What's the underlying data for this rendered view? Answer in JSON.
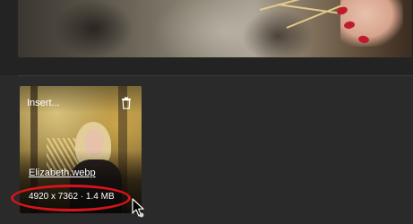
{
  "thumbnail": {
    "insert_label": "Insert...",
    "file_name": "Elizabeth.webp",
    "file_info": "4920 x 7362 · 1.4 MB",
    "delete_icon": "trash-icon"
  },
  "annotation": {
    "highlight_color": "#d7141a"
  },
  "cursor": {
    "icon": "pointer-cursor-icon"
  },
  "colors": {
    "background": "#2a2a2a",
    "text": "#ffffff",
    "nail_polish": "#c01a2c"
  }
}
